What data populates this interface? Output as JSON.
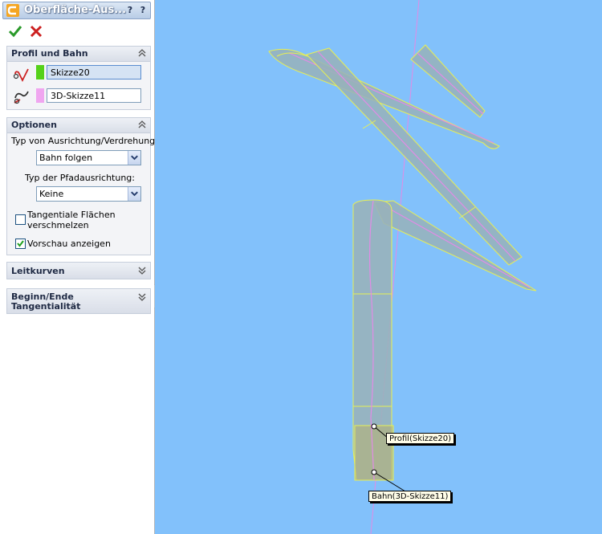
{
  "panel": {
    "title": "Oberfläche-Aus...",
    "help_label": "?",
    "icons": {
      "app": "sweep-surface-icon",
      "ok": "check-icon",
      "cancel": "x-icon",
      "help": "help-icon"
    },
    "colors": {
      "ok": "#2a9a2a",
      "cancel": "#cc2020",
      "profile_swatch": "#55d11a",
      "path_swatch": "#f0a6f0"
    }
  },
  "profile_group": {
    "title": "Profil und Bahn",
    "profile_value": "Skizze20",
    "path_value": "3D-Skizze11"
  },
  "options_group": {
    "title": "Optionen",
    "orientation_label": "Typ von Ausrichtung/Verdrehung:",
    "orientation_value": "Bahn folgen",
    "path_alignment_label": "Typ der Pfadausrichtung:",
    "path_alignment_value": "Keine",
    "merge_tangent_label_line1": "Tangentiale Flächen",
    "merge_tangent_label_line2": "verschmelzen",
    "merge_tangent_checked": false,
    "preview_label": "Vorschau anzeigen",
    "preview_checked": true
  },
  "guide_curves_group": {
    "title": "Leitkurven"
  },
  "tangency_group": {
    "title_line1": "Beginn/Ende",
    "title_line2": "Tangentialität"
  },
  "viewport": {
    "background": "#82c1fb",
    "callout_profile": "Profil(Skizze20)",
    "callout_path": "Bahn(3D-Skizze11)"
  }
}
